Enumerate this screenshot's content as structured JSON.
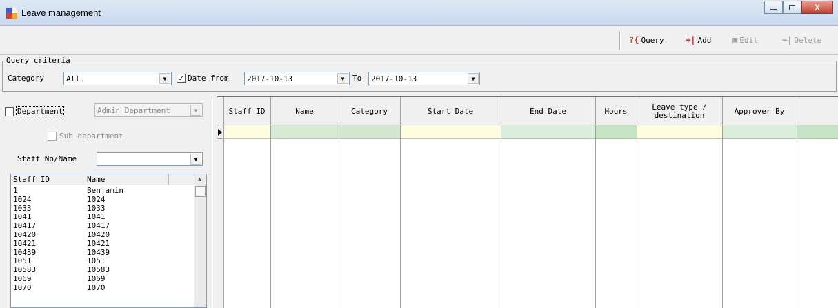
{
  "window": {
    "title": "Leave management",
    "icon": "app-grid-icon",
    "controls": [
      "minimize-icon",
      "maximize-icon",
      "close-icon"
    ],
    "close_glyph": "X"
  },
  "toolbar": {
    "query": {
      "label": "Query",
      "icon": "query-icon",
      "glyph": "?{"
    },
    "add": {
      "label": "Add",
      "icon": "add-icon",
      "glyph": "+|"
    },
    "edit": {
      "label": "Edit",
      "icon": "edit-icon",
      "glyph": "▣"
    },
    "delete": {
      "label": "Delete",
      "icon": "delete-icon",
      "glyph": "−|"
    }
  },
  "query": {
    "legend": "Query criteria",
    "category_label": "Category",
    "category_value": "All",
    "date_from_label": "Date from",
    "date_from_checked": true,
    "date_from_value": "2017-10-13",
    "to_label": "To",
    "to_value": "2017-10-13"
  },
  "left_panel": {
    "department_label": "Department",
    "department_checked": false,
    "department_value": "Admin Department",
    "sub_department_label": "Sub department",
    "staff_no_label": "Staff No/Name",
    "staff_no_value": "",
    "list_headers": [
      "Staff ID",
      "Name"
    ],
    "staff": [
      {
        "id": "1",
        "name": "Benjamin"
      },
      {
        "id": "1024",
        "name": "1024"
      },
      {
        "id": "1033",
        "name": "1033"
      },
      {
        "id": "1041",
        "name": "1041"
      },
      {
        "id": "10417",
        "name": "10417"
      },
      {
        "id": "10420",
        "name": "10420"
      },
      {
        "id": "10421",
        "name": "10421"
      },
      {
        "id": "10439",
        "name": "10439"
      },
      {
        "id": "1051",
        "name": "1051"
      },
      {
        "id": "10583",
        "name": "10583"
      },
      {
        "id": "1069",
        "name": "1069"
      },
      {
        "id": "1070",
        "name": "1070"
      }
    ]
  },
  "grid": {
    "columns": [
      "Staff ID",
      "Name",
      "Category",
      "Start Date",
      "End Date",
      "Hours",
      "Leave type / destination",
      "Approver By",
      ""
    ],
    "row_colors": [
      "#fefde0",
      "#d6ead6",
      "#d3e8d3",
      "#fefde0",
      "#dcefdc",
      "#c6e3c6",
      "#fefde0",
      "#dcefdc",
      "#c6e3c6"
    ]
  }
}
